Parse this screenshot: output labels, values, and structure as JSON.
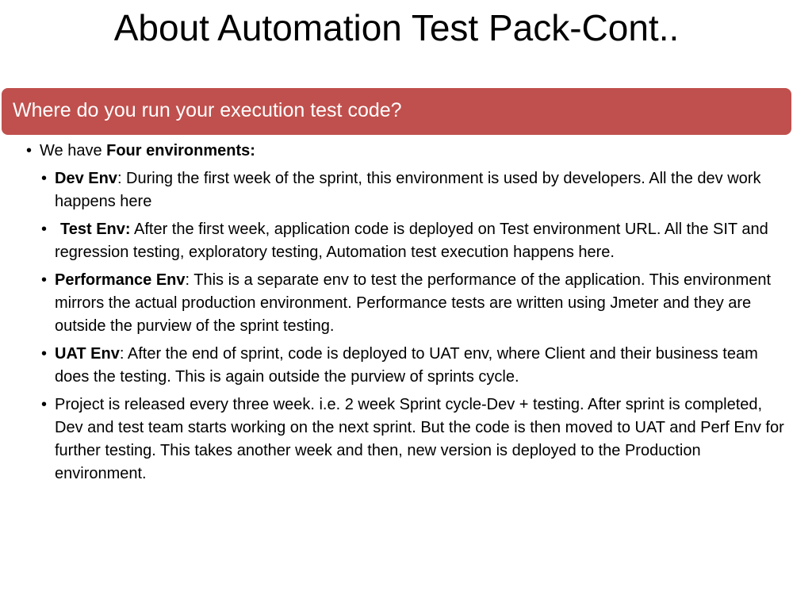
{
  "slide": {
    "title": "About Automation Test Pack-Cont..",
    "section_header": "Where do you run your execution test code?"
  },
  "intro": {
    "prefix": "We have ",
    "bold": "Four environments:"
  },
  "items": [
    {
      "label": "Dev Env",
      "text": ": During the first week of the sprint, this environment is used by developers. All the dev work happens here"
    },
    {
      "label": "Test Env:",
      "text": " After the first week, application code is deployed on Test environment URL. All the SIT and regression testing, exploratory testing, Automation test execution happens here."
    },
    {
      "label": "Performance Env",
      "text": ": This is a separate env to test the performance of the application. This environment mirrors the actual production environment. Performance tests are written using Jmeter and they are outside the purview of the sprint testing."
    },
    {
      "label": "UAT Env",
      "text": ": After the end of sprint, code is deployed to UAT env, where Client and their business team does the testing. This is again outside the purview of sprints cycle."
    },
    {
      "label": "",
      "text": "Project is released every three week. i.e. 2 week Sprint cycle-Dev + testing. After sprint is completed, Dev and test team starts working on the next sprint. But the code is then moved to UAT and Perf Env for further testing. This takes another week and then, new version is deployed to the Production environment."
    }
  ]
}
